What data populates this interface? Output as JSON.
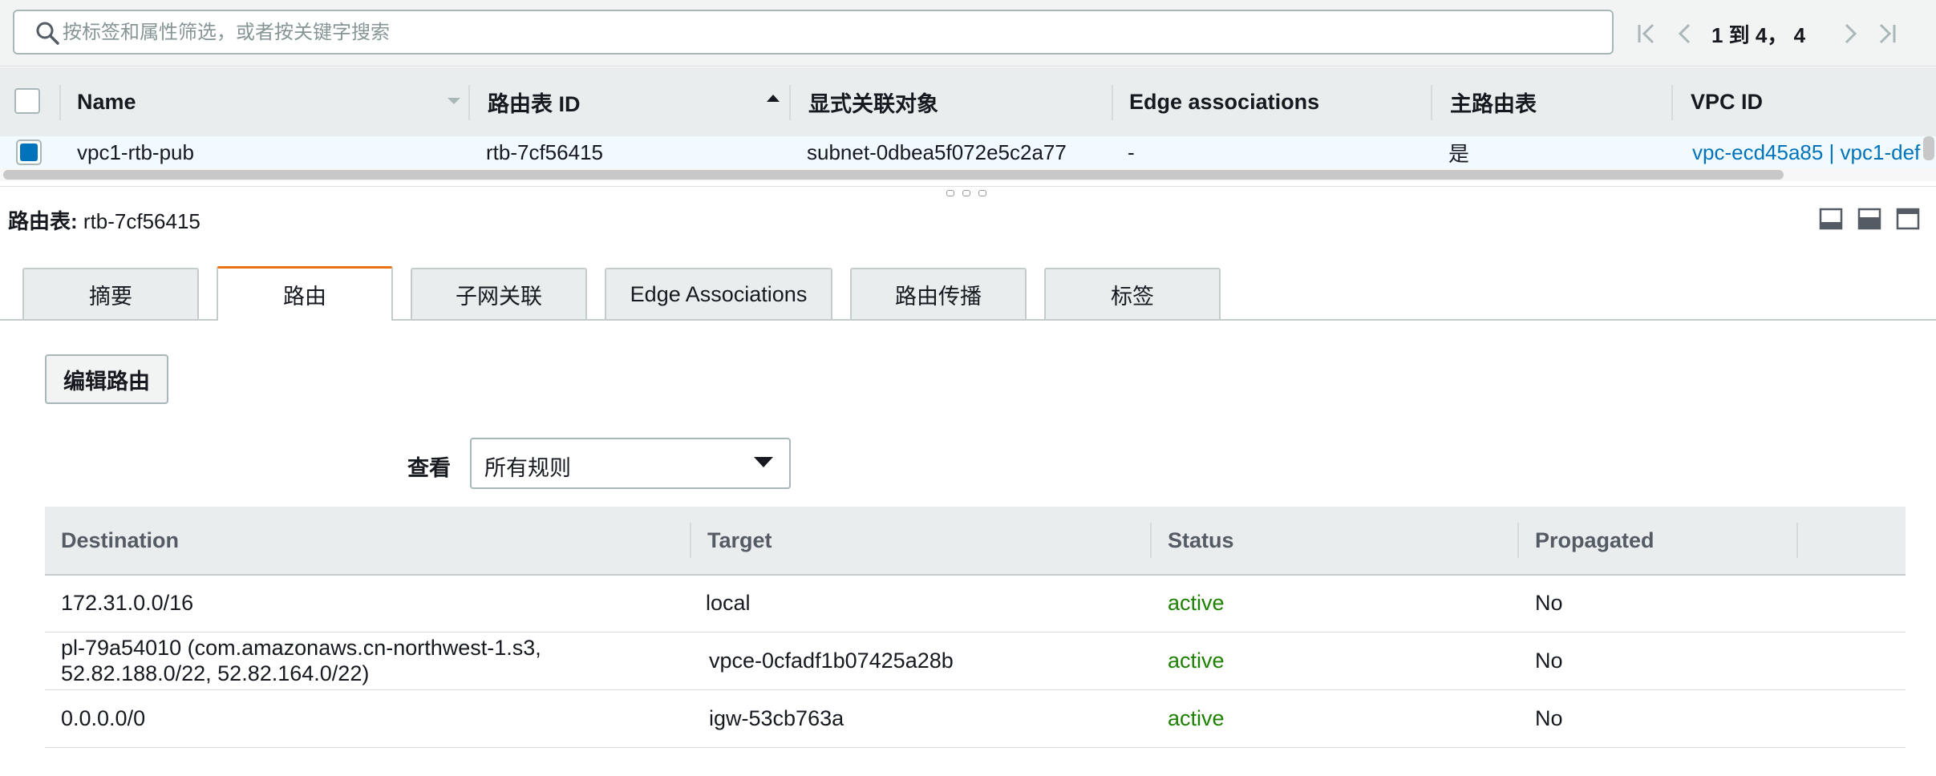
{
  "search": {
    "placeholder": "按标签和属性筛选，或者按关键字搜索"
  },
  "pager": {
    "text": "1 到 4， 4"
  },
  "grid": {
    "columns": [
      "Name",
      "路由表 ID",
      "显式关联对象",
      "Edge associations",
      "主路由表",
      "VPC ID"
    ],
    "row": {
      "name": "vpc1-rtb-pub",
      "route_table_id": "rtb-7cf56415",
      "explicit_associations": "subnet-0dbea5f072e5c2a77",
      "edge_associations": "-",
      "main": "是",
      "vpc_id": "vpc-ecd45a85 | vpc1-def"
    }
  },
  "detail": {
    "title_label": "路由表:",
    "title_value": "rtb-7cf56415",
    "tabs": [
      "摘要",
      "路由",
      "子网关联",
      "Edge Associations",
      "路由传播",
      "标签"
    ],
    "active_tab": 1,
    "edit_button": "编辑路由",
    "view_label": "查看",
    "view_value": "所有规则"
  },
  "routes": {
    "columns": [
      "Destination",
      "Target",
      "Status",
      "Propagated"
    ],
    "rows": [
      {
        "destination": "172.31.0.0/16",
        "target": "local",
        "target_is_link": false,
        "status": "active",
        "propagated": "No"
      },
      {
        "destination": "pl-79a54010 (com.amazonaws.cn-northwest-1.s3, 52.82.188.0/22, 52.82.164.0/22)",
        "target": "vpce-0cfadf1b07425a28b",
        "target_is_link": true,
        "status": "active",
        "propagated": "No"
      },
      {
        "destination": "0.0.0.0/0",
        "target": "igw-53cb763a",
        "target_is_link": true,
        "status": "active",
        "propagated": "No"
      }
    ]
  },
  "colors": {
    "link": "#0073bb",
    "active": "#1d8102",
    "tab_accent": "#ec7211",
    "selected_checkbox": "#0073bb"
  }
}
